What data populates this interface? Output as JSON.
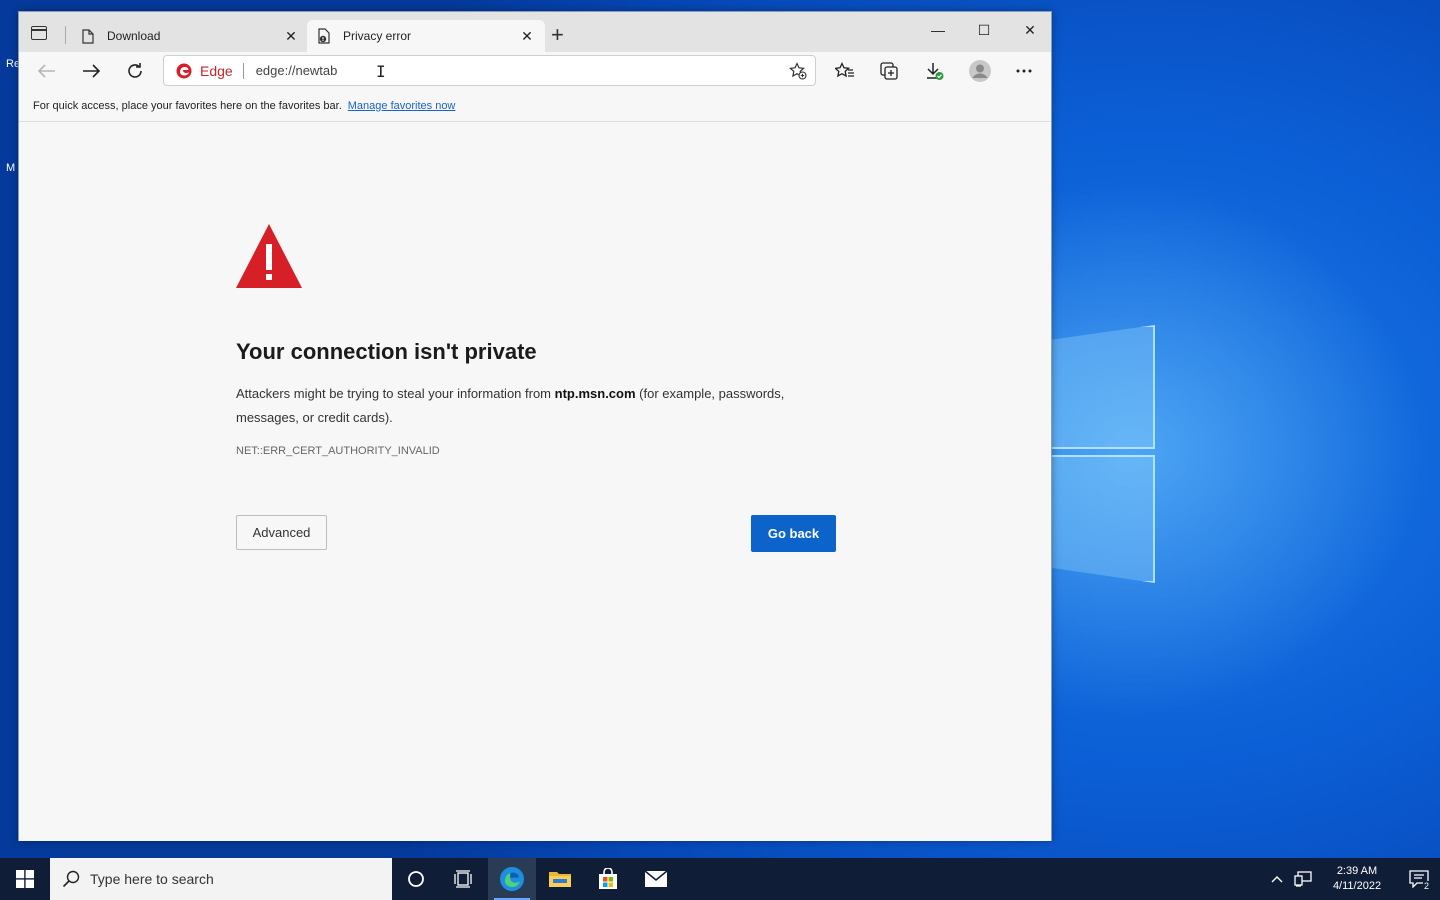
{
  "desktop": {
    "icon_hint_1": "Re",
    "icon_hint_2": "M"
  },
  "browser": {
    "tabs": [
      {
        "title": "Download",
        "icon": "document-icon",
        "active": false
      },
      {
        "title": "Privacy error",
        "icon": "privacy-error-icon",
        "active": true
      }
    ],
    "new_tab_label": "+",
    "window_controls": {
      "minimize": "—",
      "maximize": "☐",
      "close": "✕"
    },
    "address": {
      "badge_label": "Edge",
      "url": "edge://newtab"
    },
    "favorites_bar": {
      "message": "For quick access, place your favorites here on the favorites bar.",
      "link": "Manage favorites now"
    }
  },
  "error_page": {
    "title": "Your connection isn't private",
    "body_prefix": "Attackers might be trying to steal your information from",
    "host": "ntp.msn.com",
    "body_suffix": "(for example, passwords, messages, or credit cards).",
    "error_code": "NET::ERR_CERT_AUTHORITY_INVALID",
    "advanced_label": "Advanced",
    "go_back_label": "Go back"
  },
  "taskbar": {
    "search_placeholder": "Type here to search",
    "time": "2:39 AM",
    "date": "4/11/2022",
    "notification_count": "2"
  },
  "colors": {
    "accent_button": "#0c63c9",
    "warning_red": "#d61f26",
    "link_blue": "#1a62c5",
    "taskbar": "#0f1e36"
  }
}
